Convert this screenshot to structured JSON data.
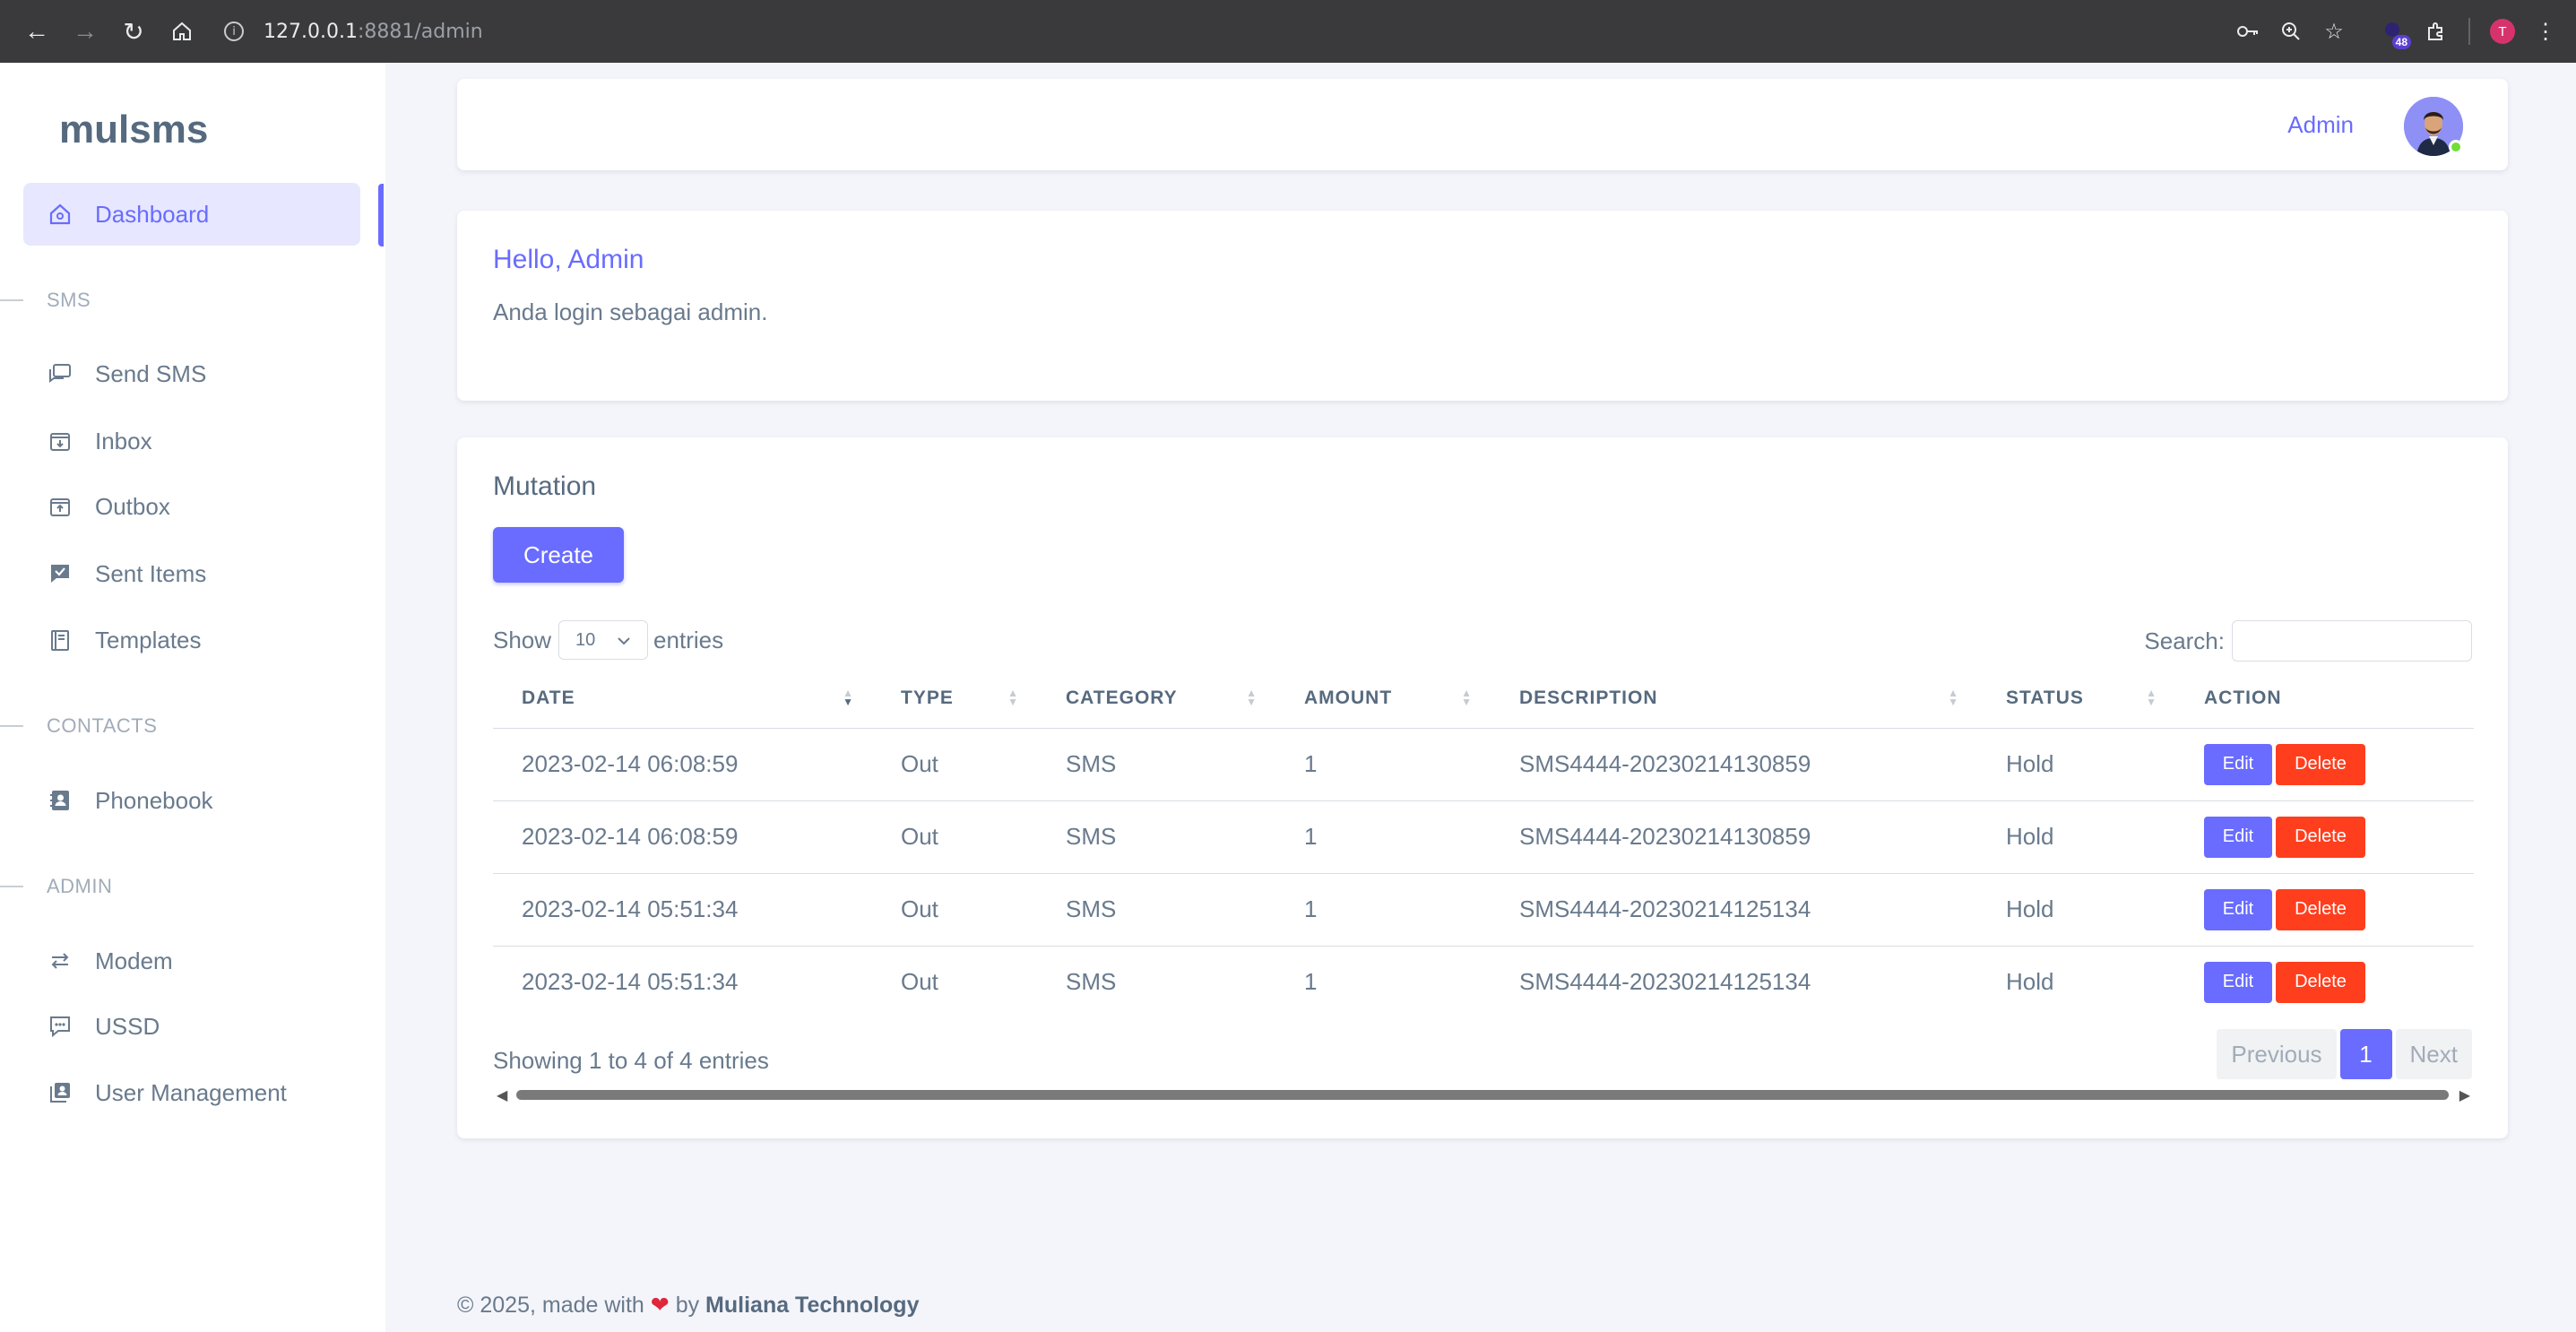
{
  "browser": {
    "url_host": "127.0.0.1",
    "url_rest": ":8881/admin",
    "extension_badge": "48",
    "profile_initial": "T"
  },
  "sidebar": {
    "brand": "mulsms",
    "dashboard": "Dashboard",
    "header_sms": "SMS",
    "send_sms": "Send SMS",
    "inbox": "Inbox",
    "outbox": "Outbox",
    "sent_items": "Sent Items",
    "templates": "Templates",
    "header_contacts": "CONTACTS",
    "phonebook": "Phonebook",
    "header_admin": "ADMIN",
    "modem": "Modem",
    "ussd": "USSD",
    "user_management": "User Management"
  },
  "navbar": {
    "user_label": "Admin"
  },
  "hello": {
    "title": "Hello, Admin",
    "text": "Anda login sebagai admin."
  },
  "mutation": {
    "title": "Mutation",
    "create_label": "Create",
    "show_label": "Show",
    "page_length": "10",
    "entries_label": "entries",
    "search_label": "Search:",
    "search_value": "",
    "columns": [
      "DATE",
      "TYPE",
      "CATEGORY",
      "AMOUNT",
      "DESCRIPTION",
      "STATUS",
      "ACTION"
    ],
    "rows": [
      {
        "date": "2023-02-14 06:08:59",
        "type": "Out",
        "category": "SMS",
        "amount": "1",
        "description": "SMS4444-20230214130859",
        "status": "Hold"
      },
      {
        "date": "2023-02-14 06:08:59",
        "type": "Out",
        "category": "SMS",
        "amount": "1",
        "description": "SMS4444-20230214130859",
        "status": "Hold"
      },
      {
        "date": "2023-02-14 05:51:34",
        "type": "Out",
        "category": "SMS",
        "amount": "1",
        "description": "SMS4444-20230214125134",
        "status": "Hold"
      },
      {
        "date": "2023-02-14 05:51:34",
        "type": "Out",
        "category": "SMS",
        "amount": "1",
        "description": "SMS4444-20230214125134",
        "status": "Hold"
      }
    ],
    "edit_label": "Edit",
    "delete_label": "Delete",
    "info": "Showing 1 to 4 of 4 entries",
    "prev_label": "Previous",
    "current_page": "1",
    "next_label": "Next"
  },
  "footer": {
    "prefix": "© 2025, made with",
    "by": "by",
    "company": "Muliana Technology"
  },
  "colors": {
    "primary": "#696cff",
    "danger": "#ff3e1d",
    "sidebar_active_bg": "#e7e7ff"
  }
}
